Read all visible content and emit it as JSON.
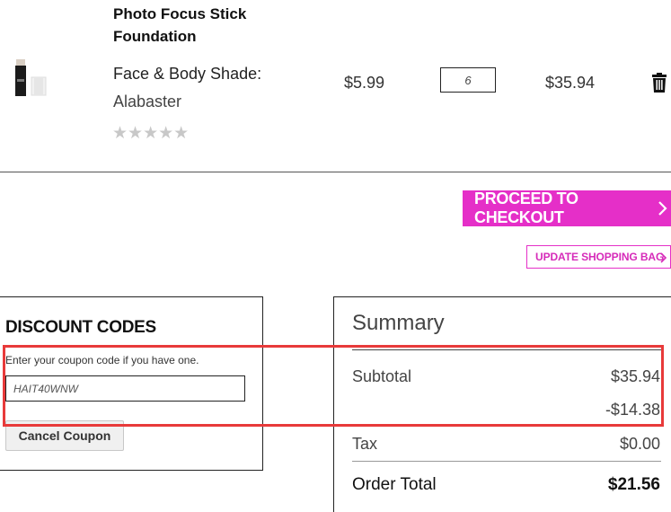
{
  "product": {
    "name": "Photo Focus Stick Foundation",
    "shade_label": "Face & Body Shade:",
    "shade_value": "Alabaster",
    "rating_stars": "★★★★★",
    "rating_filled": 0,
    "price": "$5.99",
    "quantity": "6",
    "line_total": "$35.94",
    "thumb_icon": "foundation-stick-icon",
    "remove_icon": "trash-icon"
  },
  "actions": {
    "checkout_label": "PROCEED TO CHECKOUT",
    "update_label": "UPDATE SHOPPING BAG"
  },
  "discount": {
    "title": "DISCOUNT CODES",
    "hint": "Enter your coupon code if you have one.",
    "code": "HAIT40WNW",
    "cancel_label": "Cancel Coupon"
  },
  "summary": {
    "title": "Summary",
    "subtotal_label": "Subtotal",
    "subtotal_value": "$35.94",
    "discount_value": "-$14.38",
    "tax_label": "Tax",
    "tax_value": "$0.00",
    "order_total_label": "Order Total",
    "order_total_value": "$21.56"
  },
  "colors": {
    "accent": "#e52fc8",
    "highlight": "#e83a3a"
  }
}
